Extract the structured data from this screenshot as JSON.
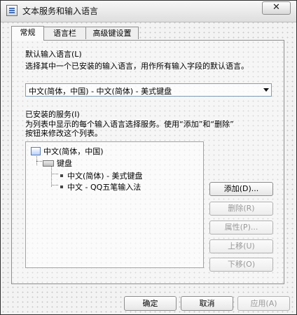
{
  "window": {
    "title": "文本服务和输入语言",
    "close_symbol": "✕"
  },
  "tabs": [
    {
      "label": "常规"
    },
    {
      "label": "语言栏"
    },
    {
      "label": "高级键设置"
    }
  ],
  "default_input": {
    "title": "默认输入语言(L)",
    "description": "选择其中一个已安装的输入语言，用作所有输入字段的默认语言。",
    "selected_value": "中文(简体，中国) - 中文(简体) - 美式键盘"
  },
  "installed_services": {
    "title": "已安装的服务(I)",
    "description_line_1": "为列表中显示的每个输入语言选择服务。使用“添加”和“删除”",
    "description_line_2": "按钮来修改这个列表。",
    "tree": {
      "language": "中文(简体，中国)",
      "keyboard_label": "键盘",
      "items": [
        "中文(简体) - 美式键盘",
        "中文 - QQ五笔输入法"
      ]
    }
  },
  "buttons": {
    "add": "添加(D)...",
    "remove": "删除(R)",
    "properties": "属性(P)...",
    "move_up": "上移(U)",
    "move_down": "下移(O)",
    "ok": "确定",
    "cancel": "取消",
    "apply": "应用(A)"
  },
  "colors": {
    "dropdown_border": "#7f9db9",
    "disabled_text": "#9a9a9a"
  }
}
